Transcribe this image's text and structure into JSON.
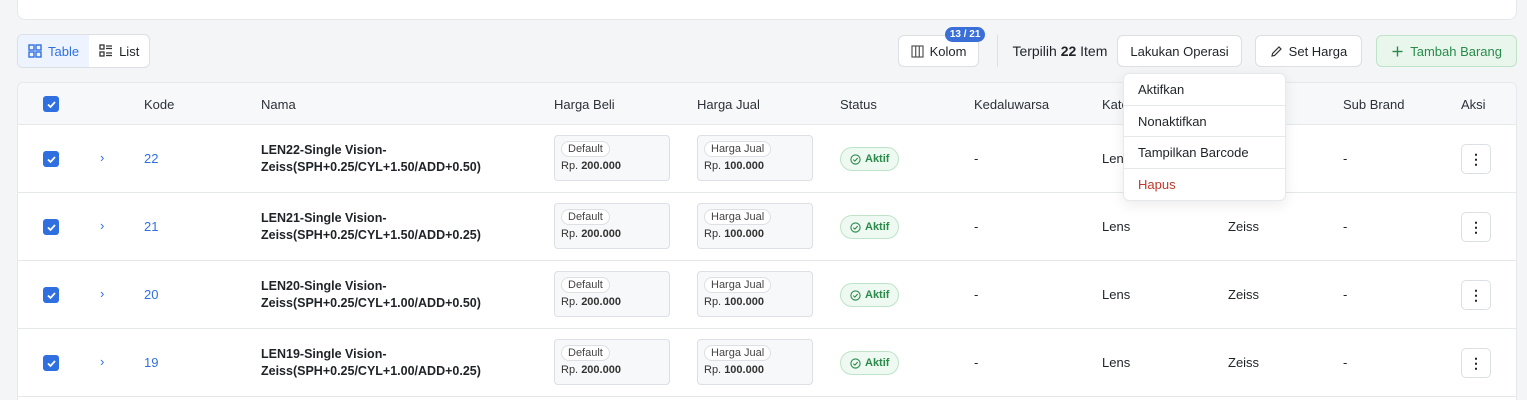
{
  "view_toggle": {
    "table_label": "Table",
    "list_label": "List",
    "active": "Table"
  },
  "toolbar": {
    "kolom_label": "Kolom",
    "kolom_badge": "13 / 21",
    "selected_prefix": "Terpilih",
    "selected_count": "22",
    "selected_suffix": "Item",
    "operation_label": "Lakukan Operasi",
    "set_price_label": "Set Harga",
    "add_label": "Tambah Barang"
  },
  "columns": {
    "kode": "Kode",
    "nama": "Nama",
    "harga_beli": "Harga Beli",
    "harga_jual": "Harga Jual",
    "status": "Status",
    "kedaluwarsa": "Kedaluwarsa",
    "kategori": "Kate",
    "sub_brand": "Sub Brand",
    "aksi": "Aksi"
  },
  "dropdown": {
    "items": [
      "Aktifkan",
      "Nonaktifkan",
      "Tampilkan Barcode",
      "Hapus"
    ]
  },
  "rows": [
    {
      "kode": "22",
      "nama": "LEN22-Single Vision-Zeiss(SPH+0.25/CYL+1.50/ADD+0.50)",
      "beli_tag": "Default",
      "beli_val": "200.000",
      "jual_tag": "Harga Jual",
      "jual_val": "100.000",
      "status": "Aktif",
      "kedaluwarsa": "-",
      "kategori": "Lens",
      "brand": "",
      "sub_brand": "-"
    },
    {
      "kode": "21",
      "nama": "LEN21-Single Vision-Zeiss(SPH+0.25/CYL+1.50/ADD+0.25)",
      "beli_tag": "Default",
      "beli_val": "200.000",
      "jual_tag": "Harga Jual",
      "jual_val": "100.000",
      "status": "Aktif",
      "kedaluwarsa": "-",
      "kategori": "Lens",
      "brand": "Zeiss",
      "sub_brand": "-"
    },
    {
      "kode": "20",
      "nama": "LEN20-Single Vision-Zeiss(SPH+0.25/CYL+1.00/ADD+0.50)",
      "beli_tag": "Default",
      "beli_val": "200.000",
      "jual_tag": "Harga Jual",
      "jual_val": "100.000",
      "status": "Aktif",
      "kedaluwarsa": "-",
      "kategori": "Lens",
      "brand": "Zeiss",
      "sub_brand": "-"
    },
    {
      "kode": "19",
      "nama": "LEN19-Single Vision-Zeiss(SPH+0.25/CYL+1.00/ADD+0.25)",
      "beli_tag": "Default",
      "beli_val": "200.000",
      "jual_tag": "Harga Jual",
      "jual_val": "100.000",
      "status": "Aktif",
      "kedaluwarsa": "-",
      "kategori": "Lens",
      "brand": "Zeiss",
      "sub_brand": "-"
    }
  ],
  "currency_prefix": "Rp.",
  "colors": {
    "accent": "#2f6fe0",
    "success": "#2a8a4a",
    "danger": "#c0392b"
  }
}
